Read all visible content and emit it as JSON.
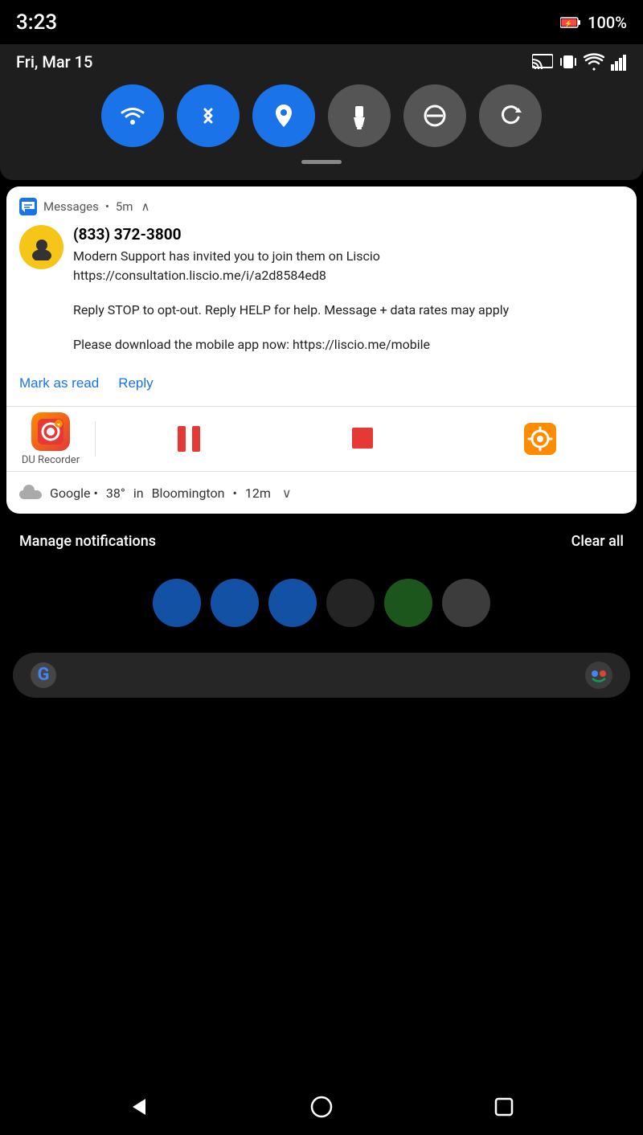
{
  "status_bar": {
    "time": "3:23",
    "battery_level": "100%"
  },
  "quick_settings": {
    "date": "Fri, Mar 15",
    "tiles": [
      {
        "id": "wifi",
        "label": "Wi-Fi",
        "active": true
      },
      {
        "id": "bluetooth",
        "label": "Bluetooth",
        "active": true
      },
      {
        "id": "location",
        "label": "Location",
        "active": true
      },
      {
        "id": "flashlight",
        "label": "Flashlight",
        "active": false
      },
      {
        "id": "dnd",
        "label": "Do Not Disturb",
        "active": false
      },
      {
        "id": "rotate",
        "label": "Auto Rotate",
        "active": false
      }
    ]
  },
  "notification_messages": {
    "app_name": "Messages",
    "time": "5m",
    "sender": "(833) 372-3800",
    "message_line1": "Modern Support has invited you to join them on Liscio https://consultation.liscio.me/i/a2d8584ed8",
    "message_line2": "Reply STOP to opt-out. Reply HELP for help. Message + data rates may apply",
    "message_line3": "Please download the mobile app now: https://liscio.me/mobile",
    "action_mark_read": "Mark as read",
    "action_reply": "Reply"
  },
  "notification_du_recorder": {
    "app_name": "DU Recorder"
  },
  "notification_weather": {
    "source": "Google",
    "temperature": "38°",
    "city": "Bloomington",
    "time": "12m"
  },
  "bottom_bar": {
    "manage_label": "Manage notifications",
    "clear_label": "Clear all"
  }
}
